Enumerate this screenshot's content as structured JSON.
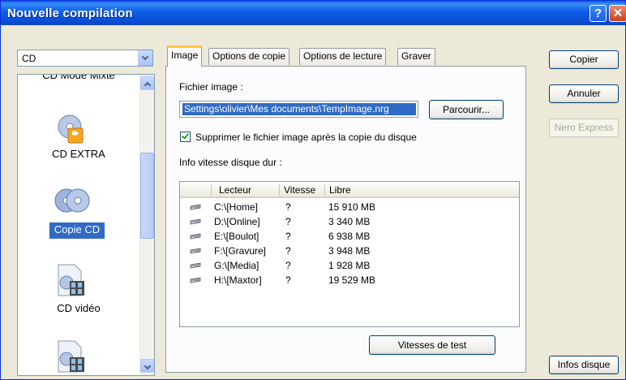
{
  "window": {
    "title": "Nouvelle compilation"
  },
  "left": {
    "combo_value": "CD",
    "items": [
      {
        "label": "CD Mode Mixte"
      },
      {
        "label": "CD EXTRA"
      },
      {
        "label": "Copie CD"
      },
      {
        "label": "CD vidéo"
      }
    ]
  },
  "tabs": [
    {
      "label": "Image"
    },
    {
      "label": "Options de copie"
    },
    {
      "label": "Options de lecture"
    },
    {
      "label": "Graver"
    }
  ],
  "image_tab": {
    "file_label": "Fichier image :",
    "file_value": "Settings\\olivier\\Mes documents\\TempImage.nrg",
    "browse_label": "Parcourir...",
    "delete_checkbox_label": "Supprimer le fichier image après la copie du disque",
    "delete_checked": true,
    "speed_info_label": "Info vitesse disque dur :",
    "columns": [
      "Lecteur",
      "Vitesse",
      "Libre"
    ],
    "drives": [
      {
        "drive": "C:\\[Home]",
        "speed": "?",
        "free": "15 910 MB"
      },
      {
        "drive": "D:\\[Online]",
        "speed": "?",
        "free": "3 340 MB"
      },
      {
        "drive": "E:\\[Boulot]",
        "speed": "?",
        "free": "6 938 MB"
      },
      {
        "drive": "F:\\[Gravure]",
        "speed": "?",
        "free": "3 948 MB"
      },
      {
        "drive": "G:\\[Media]",
        "speed": "?",
        "free": "1 928 MB"
      },
      {
        "drive": "H:\\[Maxtor]",
        "speed": "?",
        "free": "19 529 MB"
      }
    ],
    "test_speeds_label": "Vitesses de test"
  },
  "buttons": {
    "copy": "Copier",
    "cancel": "Annuler",
    "nero_express": "Nero Express",
    "disc_info": "Infos disque"
  },
  "colors": {
    "titlebar": "#0a5ae6",
    "selection": "#316ac5",
    "tab_highlight": "#ffc83c",
    "checkmark": "#21a121"
  }
}
